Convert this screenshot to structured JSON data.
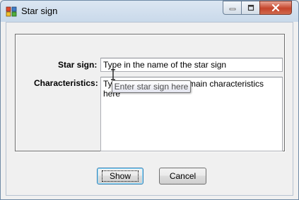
{
  "window": {
    "title": "Star sign",
    "icon": "app-window-icon",
    "controls": {
      "minimize": "minimize-icon",
      "maximize": "maximize-icon",
      "close": "close-icon"
    }
  },
  "form": {
    "star_sign_label": "Star sign:",
    "star_sign_value": "Type in the name of the star sign",
    "characteristics_label": "Characteristics:",
    "characteristics_value": "Type in this star sign's main characteristics here",
    "tooltip": "Enter star sign here"
  },
  "buttons": {
    "show": "Show",
    "cancel": "Cancel"
  },
  "colors": {
    "close_button": "#c5442b",
    "title_bar": "#c9d9ea",
    "focus_border": "#3c7fb1"
  }
}
